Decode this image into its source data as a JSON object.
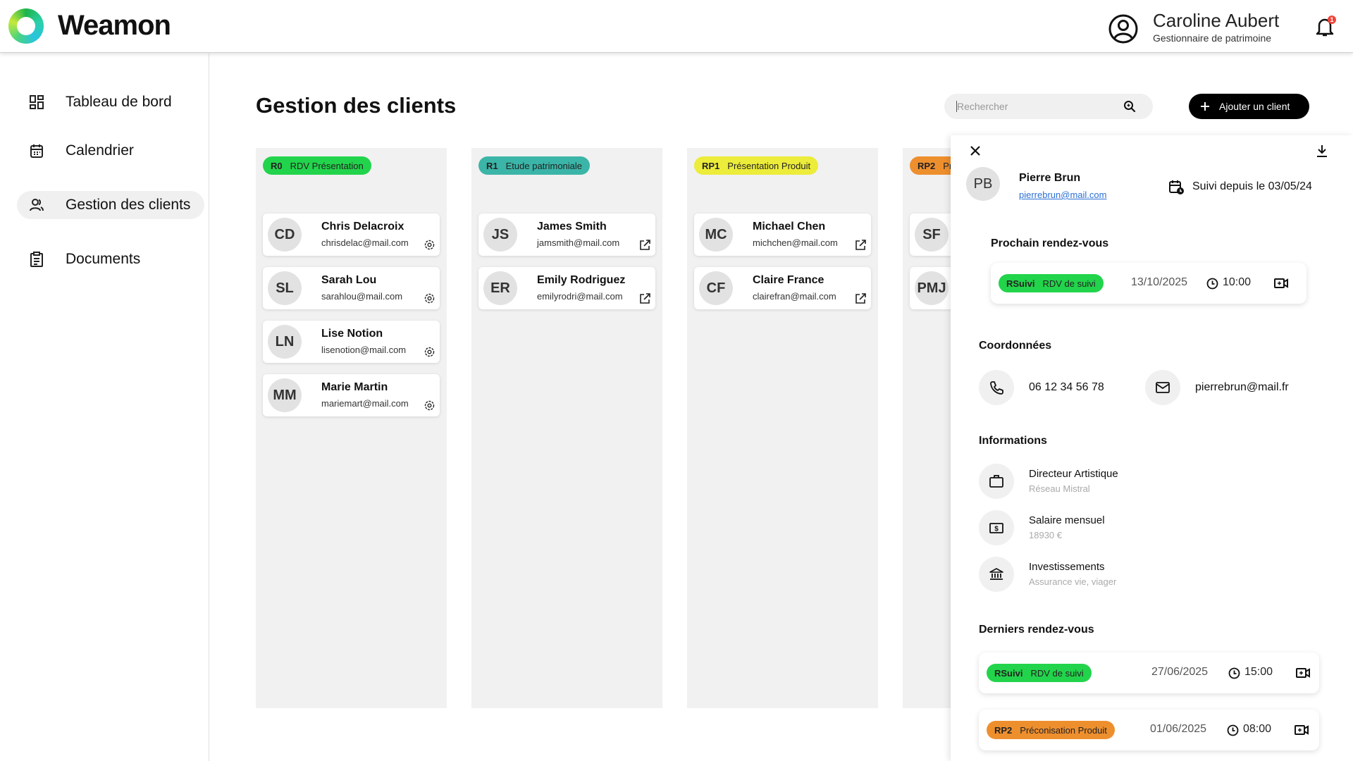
{
  "app": {
    "name": "Weamon"
  },
  "user": {
    "name": "Caroline Aubert",
    "role": "Gestionnaire de patrimoine",
    "notifications": "1"
  },
  "sidebar": {
    "items": [
      {
        "label": "Tableau de bord",
        "icon": "dashboard-icon"
      },
      {
        "label": "Calendrier",
        "icon": "calendar-icon"
      },
      {
        "label": "Gestion des clients",
        "icon": "users-icon",
        "active": true
      },
      {
        "label": "Documents",
        "icon": "document-icon"
      }
    ]
  },
  "main": {
    "title": "Gestion des clients",
    "search": {
      "placeholder": "Rechercher",
      "value": ""
    },
    "add_button": "Ajouter un client"
  },
  "columns": [
    {
      "code": "R0",
      "label": "RDV Présentation",
      "color": "#22d44b",
      "clients": [
        {
          "initials": "CD",
          "name": "Chris Delacroix",
          "email": "chrisdelac@mail.com",
          "icon": "gear-icon"
        },
        {
          "initials": "SL",
          "name": "Sarah Lou",
          "email": "sarahlou@mail.com",
          "icon": "gear-icon"
        },
        {
          "initials": "LN",
          "name": "Lise Notion",
          "email": "lisenotion@mail.com",
          "icon": "gear-icon"
        },
        {
          "initials": "MM",
          "name": "Marie Martin",
          "email": "mariemart@mail.com",
          "icon": "gear-icon"
        }
      ]
    },
    {
      "code": "R1",
      "label": "Etude patrimoniale",
      "color": "#3bb5a7",
      "clients": [
        {
          "initials": "JS",
          "name": "James Smith",
          "email": "jamsmith@mail.com",
          "icon": "external-link-icon"
        },
        {
          "initials": "ER",
          "name": "Emily Rodriguez",
          "email": "emilyrodri@mail.com",
          "icon": "external-link-icon"
        }
      ]
    },
    {
      "code": "RP1",
      "label": "Présentation Produit",
      "color": "#ecec3a",
      "clients": [
        {
          "initials": "MC",
          "name": "Michael Chen",
          "email": "michchen@mail.com",
          "icon": "external-link-icon"
        },
        {
          "initials": "CF",
          "name": "Claire France",
          "email": "clairefran@mail.com",
          "icon": "external-link-icon"
        }
      ]
    },
    {
      "code": "RP2",
      "label": "Pr",
      "color": "#ee8f2e",
      "clients": [
        {
          "initials": "SF"
        },
        {
          "initials": "PMJ"
        }
      ]
    }
  ],
  "panel": {
    "initials": "PB",
    "name": "Pierre Brun",
    "email": "pierrebrun@mail.com",
    "since": "Suivi depuis le 03/05/24",
    "next_title": "Prochain rendez-vous",
    "next": {
      "code": "RSuivi",
      "label": "RDV de suivi",
      "color": "#22d44b",
      "date": "13/10/2025",
      "time": "10:00"
    },
    "contact_title": "Coordonnées",
    "phone": "06 12 34 56 78",
    "contact_email": "pierrebrun@mail.fr",
    "info_title": "Informations",
    "infos": [
      {
        "title": "Directeur Artistique",
        "sub": "Réseau Mistral",
        "icon": "briefcase-icon"
      },
      {
        "title": "Salaire mensuel",
        "sub": "18930 €",
        "icon": "money-icon"
      },
      {
        "title": "Investissements",
        "sub": "Assurance vie, viager",
        "icon": "bank-icon"
      }
    ],
    "last_title": "Derniers rendez-vous",
    "last": [
      {
        "code": "RSuivi",
        "label": "RDV de suivi",
        "color": "#22d44b",
        "date": "27/06/2025",
        "time": "15:00"
      },
      {
        "code": "RP2",
        "label": "Préconisation Produit",
        "color": "#ee8f2e",
        "date": "01/06/2025",
        "time": "08:00"
      }
    ]
  }
}
